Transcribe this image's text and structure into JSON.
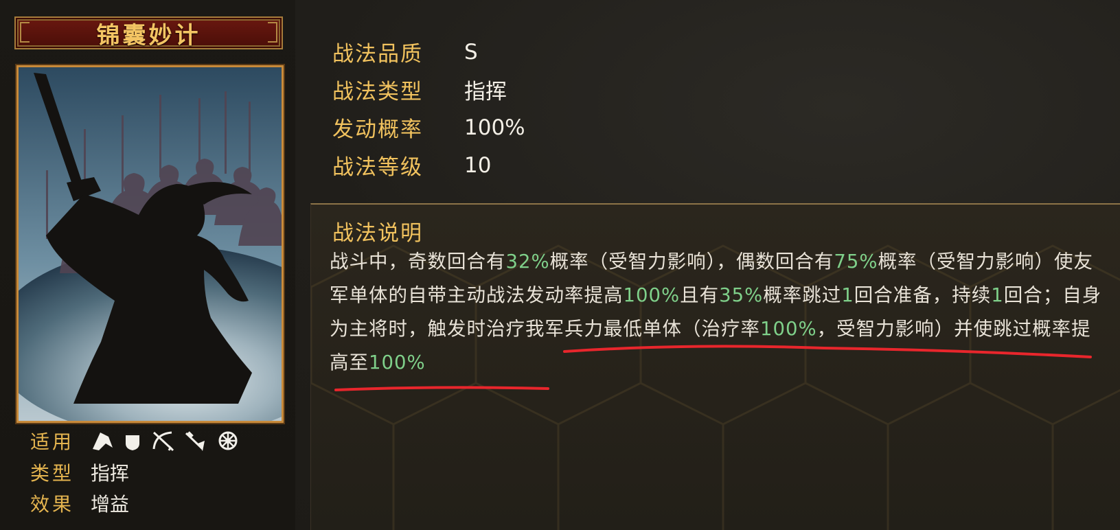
{
  "skill": {
    "name": "锦囊妙计"
  },
  "meta": {
    "applicable_label": "适用",
    "type_label": "类型",
    "type_value": "指挥",
    "effect_label": "效果",
    "effect_value": "增益",
    "unit_icons": [
      "cavalry-icon",
      "shield-icon",
      "bow-icon",
      "spear-icon",
      "wheel-icon"
    ]
  },
  "stats": [
    {
      "label": "战法品质",
      "value": "S"
    },
    {
      "label": "战法类型",
      "value": "指挥"
    },
    {
      "label": "发动概率",
      "value": "100%"
    },
    {
      "label": "战法等级",
      "value": "10"
    }
  ],
  "description": {
    "title": "战法说明",
    "segments": [
      {
        "t": "战斗中，奇数回合有"
      },
      {
        "t": "32%",
        "hl": true
      },
      {
        "t": "概率（受智力影响），偶数回合有"
      },
      {
        "t": "75%",
        "hl": true
      },
      {
        "t": "概率（受智力影响）使友军单体的自带主动战法发动率提高"
      },
      {
        "t": "100%",
        "hl": true
      },
      {
        "t": "且有"
      },
      {
        "t": "35%",
        "hl": true
      },
      {
        "t": "概率跳过"
      },
      {
        "t": "1",
        "hl": true
      },
      {
        "t": "回合准备，持续"
      },
      {
        "t": "1",
        "hl": true
      },
      {
        "t": "回合；自身为主将时，触发时治疗我军兵力最低单体（治疗率"
      },
      {
        "t": "100%",
        "hl": true
      },
      {
        "t": "，受智力影响）并使跳过概率提高至"
      },
      {
        "t": "100%",
        "hl": true
      }
    ]
  },
  "colors": {
    "label_gold": "#f1c25e",
    "highlight_green": "#7fd08a",
    "annotation_red": "#e8262c"
  }
}
